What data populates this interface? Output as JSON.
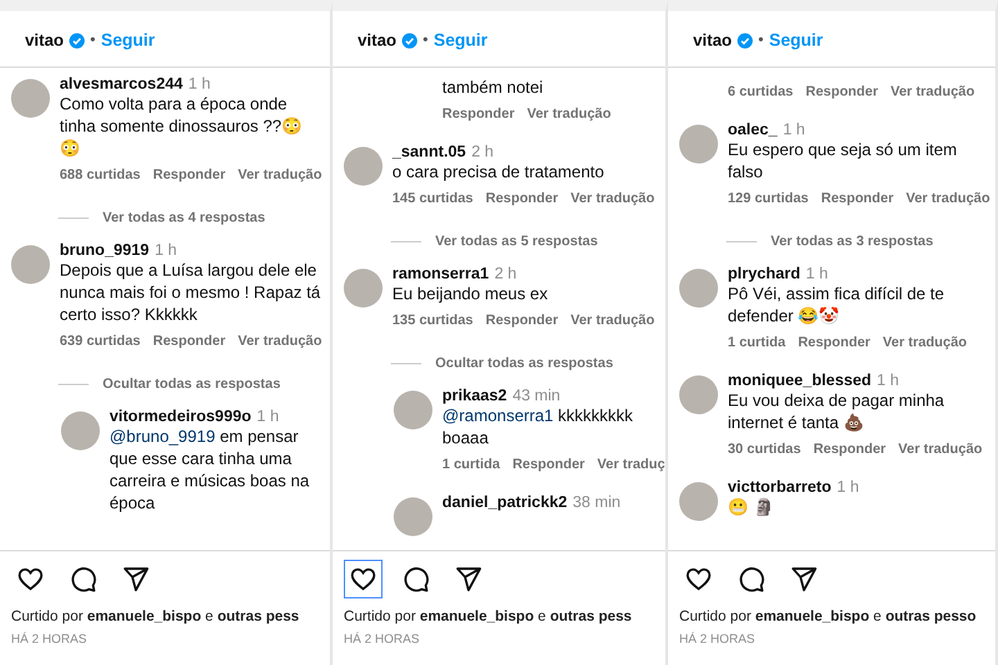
{
  "panels": [
    {
      "header": {
        "username": "vitao",
        "separator": "•",
        "follow": "Seguir"
      },
      "items": [
        {
          "kind": "comment",
          "username": "alvesmarcos244",
          "time": "1 h",
          "text": "Como volta para a época onde tinha somente dinossauros ??😳😳",
          "actions": {
            "likes": "688 curtidas",
            "reply": "Responder",
            "translate": "Ver tradução"
          }
        },
        {
          "kind": "toggle",
          "label": "Ver todas as 4 respostas"
        },
        {
          "kind": "comment",
          "username": "bruno_9919",
          "time": "1 h",
          "text": "Depois que a Luísa largou dele ele nunca mais foi o mesmo ! Rapaz tá certo isso? Kkkkkk",
          "actions": {
            "likes": "639 curtidas",
            "reply": "Responder",
            "translate": "Ver tradução"
          }
        },
        {
          "kind": "toggle",
          "label": "Ocultar todas as respostas"
        },
        {
          "kind": "reply",
          "username": "vitormedeiros999o",
          "time": "1 h",
          "mention": "@bruno_9919",
          "text": "em pensar que esse cara tinha uma carreira e músicas boas na época"
        }
      ],
      "footer": {
        "actions": [
          {
            "kind": "like",
            "focused": false
          },
          {
            "kind": "comment",
            "focused": false
          },
          {
            "kind": "share",
            "focused": false
          }
        ],
        "liked_by": "Curtido por **emanuele_bispo** e **outras pess**",
        "time": "HÁ 2 HORAS"
      }
    },
    {
      "header": {
        "username": "vitao",
        "separator": "•",
        "follow": "Seguir"
      },
      "items": [
        {
          "kind": "reply-tail",
          "text": "também notei",
          "actions": {
            "reply": "Responder",
            "translate": "Ver tradução"
          }
        },
        {
          "kind": "comment",
          "username": "_sannt.05",
          "time": "2 h",
          "text": "o cara precisa de tratamento",
          "actions": {
            "likes": "145 curtidas",
            "reply": "Responder",
            "translate": "Ver tradução"
          }
        },
        {
          "kind": "toggle",
          "label": "Ver todas as 5 respostas"
        },
        {
          "kind": "comment",
          "username": "ramonserra1",
          "time": "2 h",
          "text": "Eu beijando meus ex",
          "actions": {
            "likes": "135 curtidas",
            "reply": "Responder",
            "translate": "Ver tradução"
          }
        },
        {
          "kind": "toggle",
          "label": "Ocultar todas as respostas"
        },
        {
          "kind": "reply",
          "username": "prikaas2",
          "time": "43 min",
          "mention": "@ramonserra1",
          "text": "kkkkkkkkk boaaa",
          "actions": {
            "likes": "1 curtida",
            "reply": "Responder",
            "translate": "Ver traduç"
          }
        },
        {
          "kind": "reply",
          "username": "daniel_patrickk2",
          "time": "38 min"
        }
      ],
      "footer": {
        "actions": [
          {
            "kind": "like",
            "focused": true
          },
          {
            "kind": "comment",
            "focused": false
          },
          {
            "kind": "share",
            "focused": false
          }
        ],
        "liked_by": "Curtido por **emanuele_bispo** e **outras pess**",
        "time": "HÁ 2 HORAS"
      }
    },
    {
      "header": {
        "username": "vitao",
        "separator": "•",
        "follow": "Seguir"
      },
      "items": [
        {
          "kind": "comment-tail",
          "actions": {
            "likes": "6 curtidas",
            "reply": "Responder",
            "translate": "Ver tradução"
          }
        },
        {
          "kind": "comment",
          "username": "oalec_",
          "time": "1 h",
          "text": "Eu espero que seja só um item falso",
          "actions": {
            "likes": "129 curtidas",
            "reply": "Responder",
            "translate": "Ver tradução"
          }
        },
        {
          "kind": "toggle",
          "label": "Ver todas as 3 respostas"
        },
        {
          "kind": "comment",
          "username": "plrychard",
          "time": "1 h",
          "text": "Pô Véi, assim fica difícil de te defender 😂🤡",
          "actions": {
            "likes": "1 curtida",
            "reply": "Responder",
            "translate": "Ver tradução"
          }
        },
        {
          "kind": "comment",
          "username": "moniquee_blessed",
          "time": "1 h",
          "text": "Eu vou deixa de pagar minha internet é tanta 💩",
          "actions": {
            "likes": "30 curtidas",
            "reply": "Responder",
            "translate": "Ver tradução"
          }
        },
        {
          "kind": "comment",
          "username": "victtorbarreto",
          "time": "1 h",
          "text": "😬 🗿"
        }
      ],
      "footer": {
        "actions": [
          {
            "kind": "like",
            "focused": false
          },
          {
            "kind": "comment",
            "focused": false
          },
          {
            "kind": "share",
            "focused": false
          }
        ],
        "liked_by": "Curtido por **emanuele_bispo** e **outras pesso**",
        "time": "HÁ 2 HORAS"
      }
    }
  ]
}
